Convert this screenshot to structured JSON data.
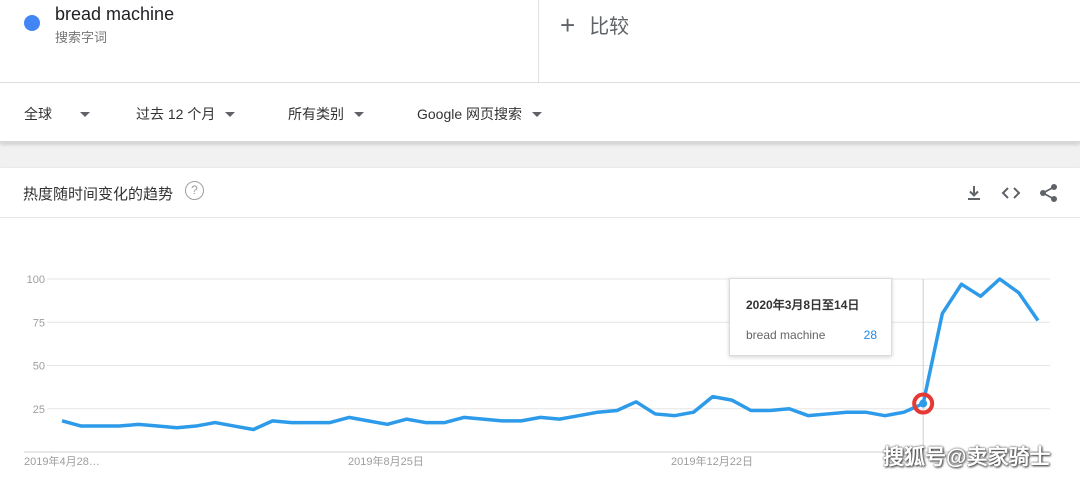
{
  "search": {
    "term": "bread machine",
    "term_subtitle": "搜索字词",
    "term_color": "#4285f4",
    "compare_label": "比较"
  },
  "filters": {
    "region": "全球",
    "time_range": "过去 12 个月",
    "category": "所有类别",
    "search_type": "Google 网页搜索"
  },
  "card": {
    "title": "热度随时间变化的趋势",
    "help_glyph": "?",
    "tools": [
      "download-icon",
      "embed-icon",
      "share-icon"
    ]
  },
  "chart_data": {
    "type": "line",
    "y_ticks": [
      25,
      50,
      75,
      100
    ],
    "ylim": [
      0,
      100
    ],
    "x_labels": [
      "2019年4月28…",
      "2019年8月25日",
      "2019年12月22日"
    ],
    "series": [
      {
        "name": "bread machine",
        "color": "#2d9be9",
        "values": [
          18,
          15,
          15,
          15,
          16,
          15,
          14,
          15,
          17,
          15,
          13,
          18,
          17,
          17,
          17,
          20,
          18,
          16,
          19,
          17,
          17,
          20,
          19,
          18,
          18,
          20,
          19,
          21,
          23,
          24,
          29,
          22,
          21,
          23,
          32,
          30,
          24,
          24,
          25,
          21,
          22,
          23,
          23,
          21,
          23,
          28,
          80,
          97,
          90,
          100,
          92,
          76
        ]
      }
    ],
    "highlight_index": 45,
    "highlight_color": "#e53935"
  },
  "tooltip": {
    "date": "2020年3月8日至14日",
    "term": "bread machine",
    "value": "28"
  },
  "watermark": "搜狐号@卖家骑士"
}
